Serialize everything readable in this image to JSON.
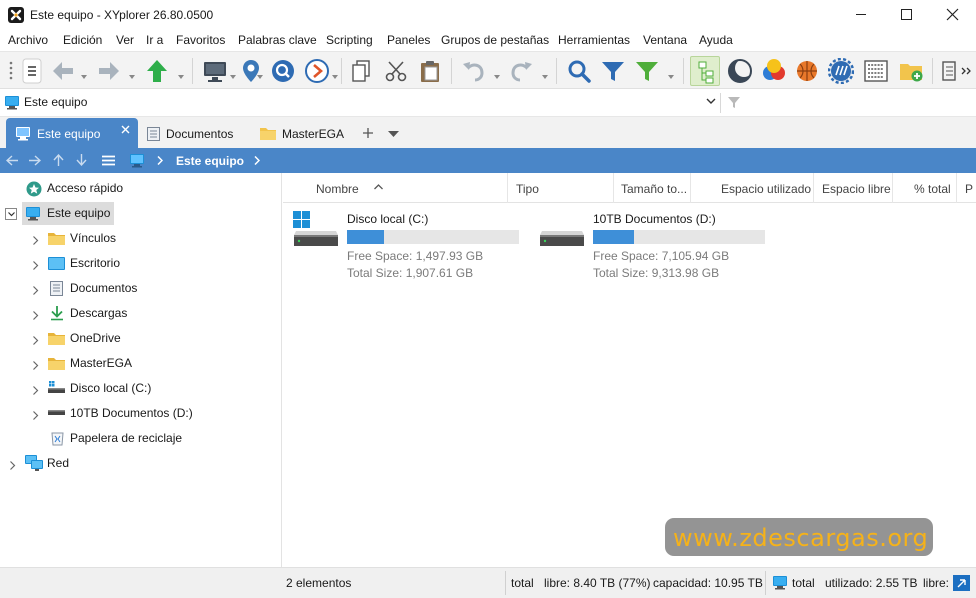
{
  "window": {
    "title": "Este equipo - XYplorer 26.80.0500"
  },
  "menu": [
    "Archivo",
    "Edición",
    "Ver",
    "Ir a",
    "Favoritos",
    "Palabras clave",
    "Scripting",
    "Paneles",
    "Grupos de pestañas",
    "Herramientas",
    "Ventana",
    "Ayuda"
  ],
  "address": {
    "value": "Este equipo"
  },
  "tabs": [
    {
      "label": "Este equipo",
      "active": true
    },
    {
      "label": "Documentos",
      "active": false
    },
    {
      "label": "MasterEGA",
      "active": false
    }
  ],
  "breadcrumb": {
    "location": "Este equipo"
  },
  "tree": [
    {
      "label": "Acceso rápido",
      "icon": "quick-access-icon"
    },
    {
      "label": "Este equipo",
      "icon": "computer-icon",
      "selected": true
    },
    {
      "label": "Vínculos",
      "icon": "folder-icon"
    },
    {
      "label": "Escritorio",
      "icon": "desktop-icon"
    },
    {
      "label": "Documentos",
      "icon": "documents-icon"
    },
    {
      "label": "Descargas",
      "icon": "download-icon"
    },
    {
      "label": "OneDrive",
      "icon": "folder-icon"
    },
    {
      "label": "MasterEGA",
      "icon": "folder-icon"
    },
    {
      "label": "Disco local (C:)",
      "icon": "drive-icon"
    },
    {
      "label": "10TB Documentos (D:)",
      "icon": "drive-icon"
    },
    {
      "label": "Papelera de reciclaje",
      "icon": "recycle-bin-icon"
    },
    {
      "label": "Red",
      "icon": "network-icon"
    }
  ],
  "columns": [
    "Nombre",
    "Tipo",
    "Tamaño to...",
    "Espacio utilizado",
    "Espacio libre",
    "% total",
    "P"
  ],
  "drives": [
    {
      "name": "Disco local (C:)",
      "free": "Free Space: 1,497.93 GB",
      "total": "Total Size: 1,907.61 GB",
      "used_fraction": 0.215
    },
    {
      "name": "10TB Documentos (D:)",
      "free": "Free Space: 7,105.94 GB",
      "total": "Total Size: 9,313.98 GB",
      "used_fraction": 0.237
    }
  ],
  "status": {
    "count": "2 elementos",
    "total_label": "total",
    "free": "libre: 8.40 TB (77%)",
    "capacity": "capacidad: 10.95 TB",
    "total_label2": "total",
    "used": "utilizado: 2.55 TB",
    "free2": "libre:"
  },
  "watermark": "www.zdescargas.org",
  "colors": {
    "accent": "#4a86c8",
    "bar": "#3e8fd8",
    "watermark_text": "#f5b21a"
  }
}
